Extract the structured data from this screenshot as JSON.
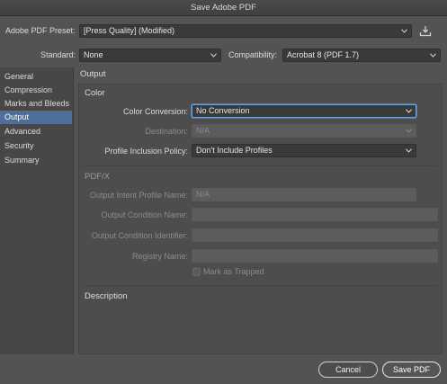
{
  "window": {
    "title": "Save Adobe PDF"
  },
  "preset": {
    "label": "Adobe PDF Preset:",
    "value": "[Press Quality] (Modified)"
  },
  "standard": {
    "label": "Standard:",
    "value": "None"
  },
  "compatibility": {
    "label": "Compatibility:",
    "value": "Acrobat 8 (PDF 1.7)"
  },
  "sidebar": {
    "items": [
      {
        "label": "General"
      },
      {
        "label": "Compression"
      },
      {
        "label": "Marks and Bleeds"
      },
      {
        "label": "Output"
      },
      {
        "label": "Advanced"
      },
      {
        "label": "Security"
      },
      {
        "label": "Summary"
      }
    ]
  },
  "main": {
    "heading": "Output",
    "color": {
      "title": "Color",
      "conversion": {
        "label": "Color Conversion:",
        "value": "No Conversion"
      },
      "destination": {
        "label": "Destination:",
        "value": "N/A"
      },
      "profile_policy": {
        "label": "Profile Inclusion Policy:",
        "value": "Don't Include Profiles"
      }
    },
    "pdfx": {
      "title": "PDF/X",
      "intent_profile": {
        "label": "Output Intent Profile Name:",
        "value": "N/A"
      },
      "condition_name": {
        "label": "Output Condition Name:"
      },
      "condition_identifier": {
        "label": "Output Condition Identifier:"
      },
      "registry_name": {
        "label": "Registry Name:"
      },
      "mark_trapped": {
        "label": "Mark as Trapped"
      }
    },
    "description": {
      "title": "Description"
    }
  },
  "footer": {
    "cancel_label": "Cancel",
    "save_label": "Save PDF"
  },
  "colors": {
    "accent": "#4d6f9c",
    "focus": "#6f9ed6",
    "background": "#535353"
  }
}
